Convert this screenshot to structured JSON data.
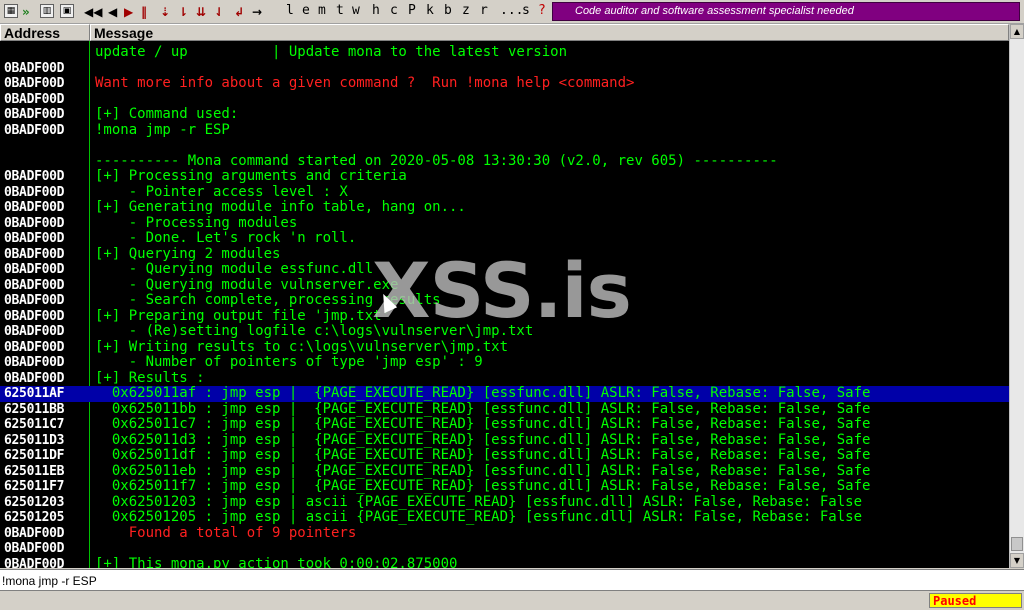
{
  "toolbar": {
    "letters": [
      "l",
      "e",
      "m",
      "t",
      "w",
      "h",
      "c",
      "P",
      "k",
      "b",
      "z",
      "r",
      "...",
      "s",
      "?"
    ],
    "banner": "Code auditor and software assessment specialist needed"
  },
  "header": {
    "address_label": "Address",
    "message_label": "Message"
  },
  "watermark": "XSS.is",
  "rows": [
    {
      "addr": "",
      "msg": "update / up          | Update mona to the latest version",
      "color": "green"
    },
    {
      "addr": "0BADF00D",
      "msg": "",
      "color": "green"
    },
    {
      "addr": "0BADF00D",
      "msg": "Want more info about a given command ?  Run !mona help <command>",
      "color": "red"
    },
    {
      "addr": "0BADF00D",
      "msg": "",
      "color": "green"
    },
    {
      "addr": "0BADF00D",
      "msg": "[+] Command used:",
      "color": "green"
    },
    {
      "addr": "0BADF00D",
      "msg": "!mona jmp -r ESP",
      "color": "green"
    },
    {
      "addr": "",
      "msg": "",
      "color": "green"
    },
    {
      "addr": "",
      "msg": "---------- Mona command started on 2020-05-08 13:30:30 (v2.0, rev 605) ----------",
      "color": "green"
    },
    {
      "addr": "0BADF00D",
      "msg": "[+] Processing arguments and criteria",
      "color": "green"
    },
    {
      "addr": "0BADF00D",
      "msg": "    - Pointer access level : X",
      "color": "green"
    },
    {
      "addr": "0BADF00D",
      "msg": "[+] Generating module info table, hang on...",
      "color": "green"
    },
    {
      "addr": "0BADF00D",
      "msg": "    - Processing modules",
      "color": "green"
    },
    {
      "addr": "0BADF00D",
      "msg": "    - Done. Let's rock 'n roll.",
      "color": "green"
    },
    {
      "addr": "0BADF00D",
      "msg": "[+] Querying 2 modules",
      "color": "green"
    },
    {
      "addr": "0BADF00D",
      "msg": "    - Querying module essfunc.dll",
      "color": "green"
    },
    {
      "addr": "0BADF00D",
      "msg": "    - Querying module vulnserver.exe",
      "color": "green"
    },
    {
      "addr": "0BADF00D",
      "msg": "    - Search complete, processing results",
      "color": "green"
    },
    {
      "addr": "0BADF00D",
      "msg": "[+] Preparing output file 'jmp.txt'",
      "color": "green"
    },
    {
      "addr": "0BADF00D",
      "msg": "    - (Re)setting logfile c:\\logs\\vulnserver\\jmp.txt",
      "color": "green"
    },
    {
      "addr": "0BADF00D",
      "msg": "[+] Writing results to c:\\logs\\vulnserver\\jmp.txt",
      "color": "green"
    },
    {
      "addr": "0BADF00D",
      "msg": "    - Number of pointers of type 'jmp esp' : 9",
      "color": "green"
    },
    {
      "addr": "0BADF00D",
      "msg": "[+] Results :",
      "color": "green"
    },
    {
      "addr": "625011AF",
      "msg": "  0x625011af : jmp esp |  {PAGE_EXECUTE_READ} [essfunc.dll] ASLR: False, Rebase: False, Safe",
      "color": "green",
      "selected": true
    },
    {
      "addr": "625011BB",
      "msg": "  0x625011bb : jmp esp |  {PAGE_EXECUTE_READ} [essfunc.dll] ASLR: False, Rebase: False, Safe",
      "color": "green"
    },
    {
      "addr": "625011C7",
      "msg": "  0x625011c7 : jmp esp |  {PAGE_EXECUTE_READ} [essfunc.dll] ASLR: False, Rebase: False, Safe",
      "color": "green"
    },
    {
      "addr": "625011D3",
      "msg": "  0x625011d3 : jmp esp |  {PAGE_EXECUTE_READ} [essfunc.dll] ASLR: False, Rebase: False, Safe",
      "color": "green"
    },
    {
      "addr": "625011DF",
      "msg": "  0x625011df : jmp esp |  {PAGE_EXECUTE_READ} [essfunc.dll] ASLR: False, Rebase: False, Safe",
      "color": "green"
    },
    {
      "addr": "625011EB",
      "msg": "  0x625011eb : jmp esp |  {PAGE_EXECUTE_READ} [essfunc.dll] ASLR: False, Rebase: False, Safe",
      "color": "green"
    },
    {
      "addr": "625011F7",
      "msg": "  0x625011f7 : jmp esp |  {PAGE_EXECUTE_READ} [essfunc.dll] ASLR: False, Rebase: False, Safe",
      "color": "green"
    },
    {
      "addr": "62501203",
      "msg": "  0x62501203 : jmp esp | ascii {PAGE_EXECUTE_READ} [essfunc.dll] ASLR: False, Rebase: False",
      "color": "green"
    },
    {
      "addr": "62501205",
      "msg": "  0x62501205 : jmp esp | ascii {PAGE_EXECUTE_READ} [essfunc.dll] ASLR: False, Rebase: False",
      "color": "green"
    },
    {
      "addr": "0BADF00D",
      "msg": "    Found a total of 9 pointers",
      "color": "red"
    },
    {
      "addr": "0BADF00D",
      "msg": "",
      "color": "green"
    },
    {
      "addr": "0BADF00D",
      "msg": "[+] This mona.py action took 0:00:02.875000",
      "color": "green"
    }
  ],
  "command": {
    "value": "!mona jmp -r ESP"
  },
  "status": {
    "state": "Paused"
  },
  "colors": {
    "log_bg": "#000000",
    "green": "#00ff00",
    "red": "#ff2020",
    "selected": "#0000a8",
    "banner": "#800080",
    "paused_bg": "#ffff00"
  }
}
